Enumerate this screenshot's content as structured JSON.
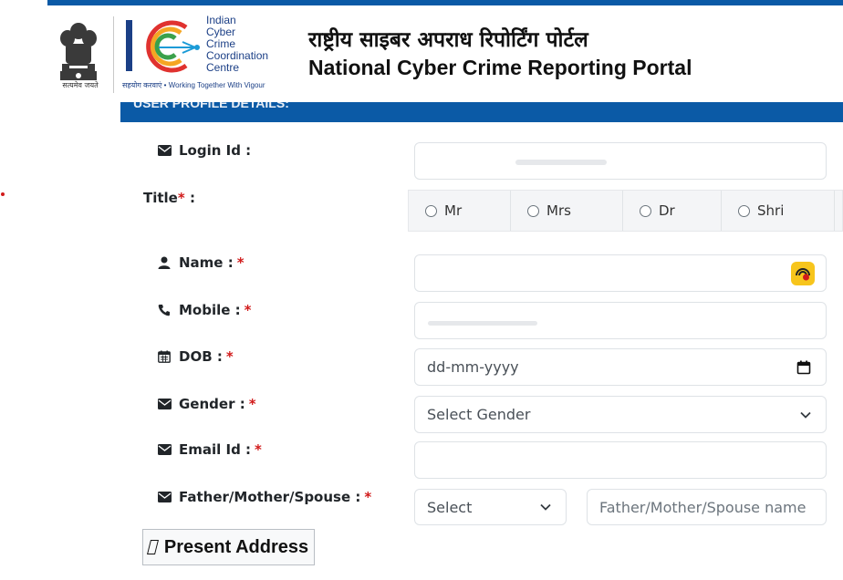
{
  "header": {
    "emblem_caption": "सत्यमेव जयते",
    "i4c_words": [
      "Indian",
      "Cyber",
      "Crime",
      "Coordination",
      "Centre"
    ],
    "i4c_tagline": "सहयोग करवाएं • Working Together With Vigour",
    "title_hindi": "राष्ट्रीय साइबर अपराध रिपोर्टिंग पोर्टल",
    "title_english": "National Cyber Crime Reporting Portal"
  },
  "section": {
    "title": "USER PROFILE DETAILS:"
  },
  "form": {
    "login": {
      "label": "Login Id :"
    },
    "title": {
      "label": "Title",
      "required_mark": "*",
      "suffix": " :",
      "options": [
        "Mr",
        "Mrs",
        "Dr",
        "Shri"
      ]
    },
    "name": {
      "label": "Name :",
      "required_mark": "*"
    },
    "mobile": {
      "label": "Mobile :",
      "required_mark": "*"
    },
    "dob": {
      "label": "DOB :",
      "required_mark": "*",
      "placeholder": "dd-mm-yyyy"
    },
    "gender": {
      "label": "Gender :",
      "required_mark": "*",
      "selected": "Select Gender"
    },
    "email": {
      "label": "Email Id :",
      "required_mark": "*"
    },
    "relation": {
      "label": "Father/Mother/Spouse :",
      "required_mark": "*",
      "select_value": "Select",
      "name_placeholder": "Father/Mother/Spouse name"
    },
    "present_address_button": "Present Address"
  },
  "colors": {
    "brand_blue": "#0b5aa6",
    "required_red": "#d11a1a",
    "mic_yellow": "#f7c51c"
  },
  "icons": {
    "login": "envelope-icon",
    "name": "user-icon",
    "mobile": "phone-icon",
    "dob": "calendar-icon",
    "gender": "envelope-icon",
    "email": "envelope-icon",
    "relation": "envelope-icon",
    "mic": "microphone-icon"
  }
}
